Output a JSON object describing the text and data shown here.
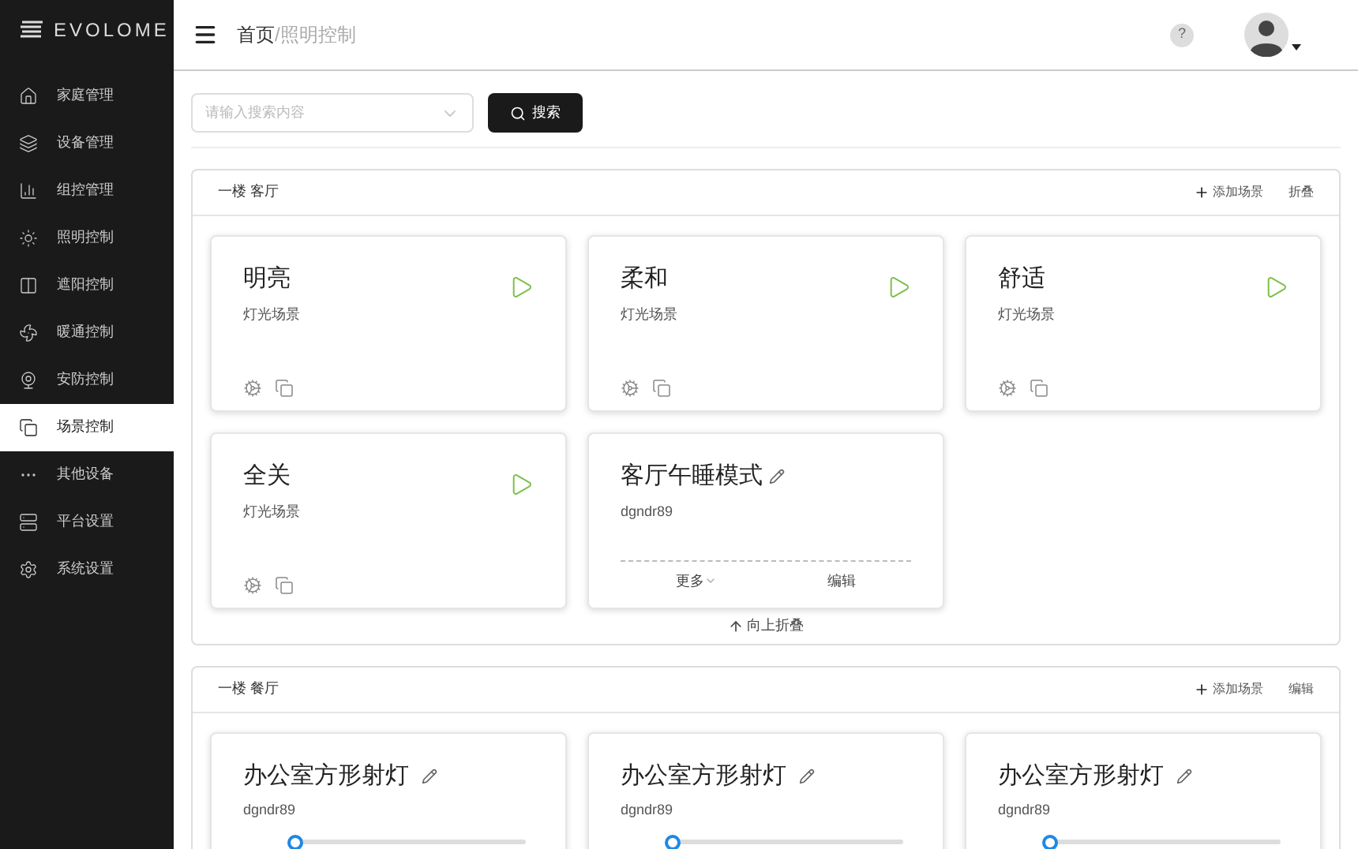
{
  "sidebar": {
    "logo": "EVOLOME",
    "items": [
      {
        "label": "家庭管理",
        "selected": false
      },
      {
        "label": "设备管理",
        "selected": false
      },
      {
        "label": "组控管理",
        "selected": false
      },
      {
        "label": "照明控制",
        "selected": false
      },
      {
        "label": "遮阳控制",
        "selected": false
      },
      {
        "label": "暖通控制",
        "selected": false
      },
      {
        "label": "安防控制",
        "selected": false
      },
      {
        "label": "场景控制",
        "selected": true
      },
      {
        "label": "其他设备",
        "selected": false
      },
      {
        "label": "平台设置",
        "selected": false
      },
      {
        "label": "系统设置",
        "selected": false
      }
    ]
  },
  "header": {
    "breadcrumb": {
      "home": "首页",
      "separator": "/",
      "current": "照明控制"
    },
    "help": "?"
  },
  "search": {
    "placeholder": "请输入搜索内容",
    "button": "搜索"
  },
  "groups": [
    {
      "title": "一楼 客厅",
      "add": "添加场景",
      "action": "折叠",
      "collapse": "向上折叠",
      "cards": [
        {
          "kind": "scene",
          "title": "明亮",
          "subtitle": "灯光场景"
        },
        {
          "kind": "scene",
          "title": "柔和",
          "subtitle": "灯光场景"
        },
        {
          "kind": "scene",
          "title": "舒适",
          "subtitle": "灯光场景"
        },
        {
          "kind": "scene",
          "title": "全关",
          "subtitle": "灯光场景"
        },
        {
          "kind": "custom",
          "title": "客厅午睡模式",
          "subtitle": "dgndr89",
          "more": "更多",
          "edit": "编辑"
        }
      ]
    },
    {
      "title": "一楼 餐厅",
      "add": "添加场景",
      "action": "编辑",
      "cards": [
        {
          "kind": "light",
          "title": "办公室方形射灯",
          "subtitle": "dgndr89",
          "level": 0
        },
        {
          "kind": "light",
          "title": "办公室方形射灯",
          "subtitle": "dgndr89",
          "level": 0
        },
        {
          "kind": "light",
          "title": "办公室方形射灯",
          "subtitle": "dgndr89",
          "level": 0
        }
      ]
    }
  ]
}
